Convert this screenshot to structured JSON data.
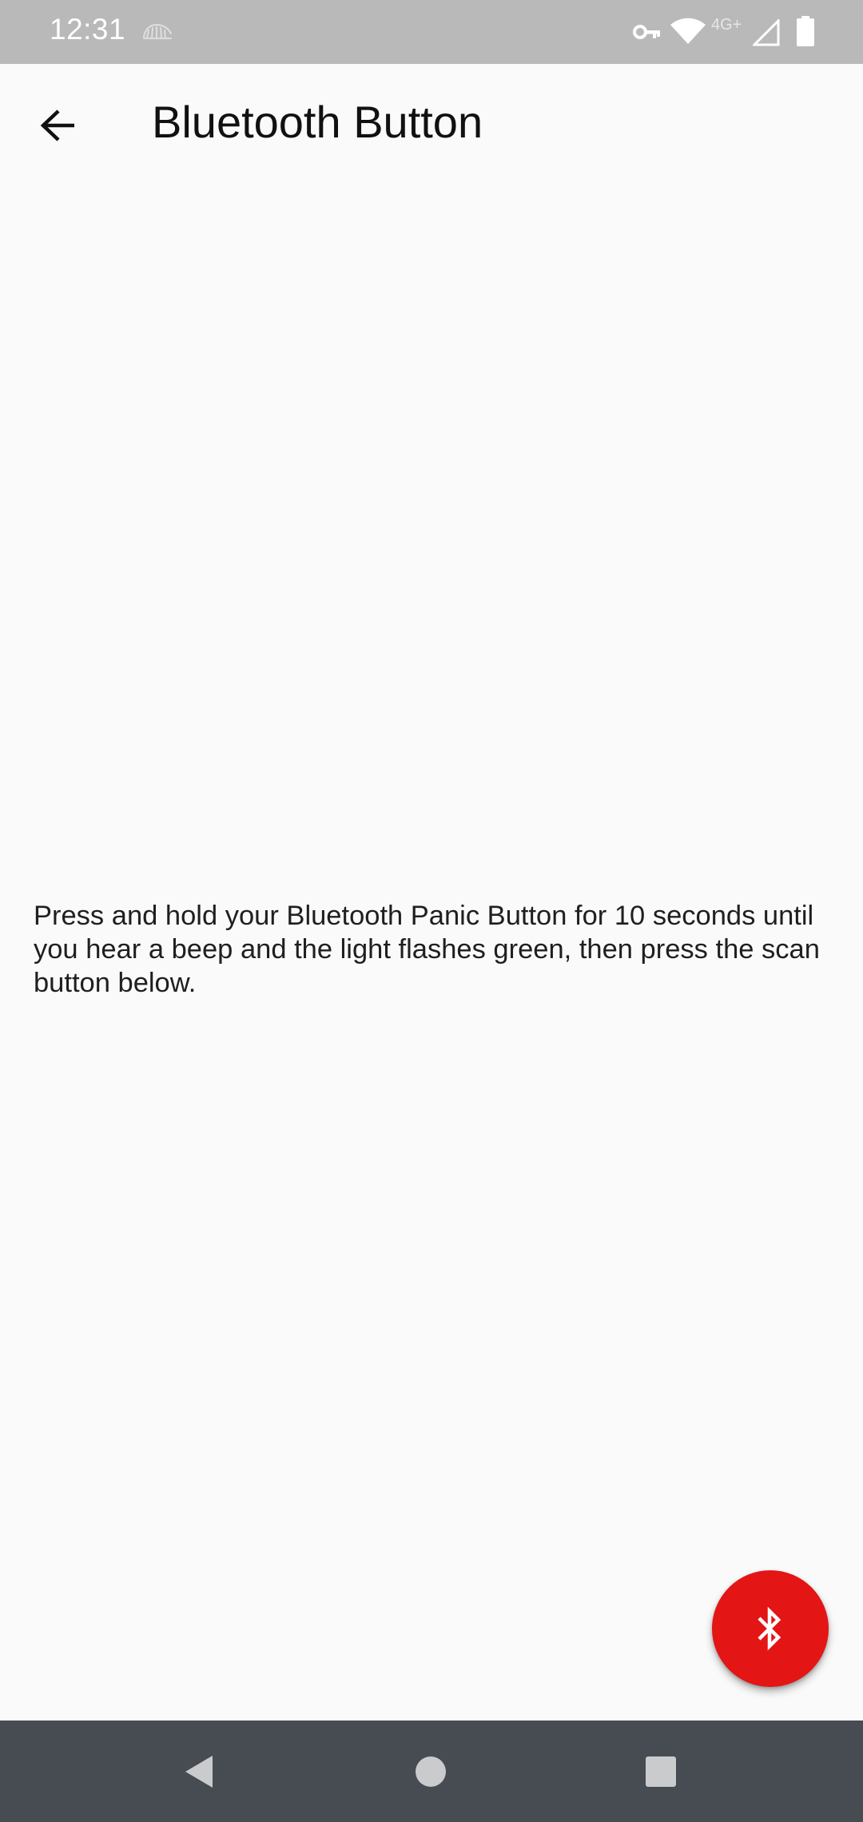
{
  "status_bar": {
    "time": "12:31",
    "network_label": "4G+",
    "icons": [
      "hand-wave-icon",
      "vpn-key-icon",
      "wifi-icon",
      "signal-icon",
      "battery-icon"
    ]
  },
  "app_bar": {
    "title": "Bluetooth Button",
    "back_icon": "arrow-back-icon"
  },
  "main": {
    "instructions": "Press and hold your Bluetooth Panic Button for 10 seconds until you hear a beep and the light flashes green, then press the scan button below."
  },
  "fab": {
    "icon": "bluetooth-icon",
    "color": "#e31515"
  },
  "nav_bar": {
    "buttons": [
      "back-triangle-icon",
      "home-circle-icon",
      "recents-square-icon"
    ],
    "color": "#464c52"
  }
}
